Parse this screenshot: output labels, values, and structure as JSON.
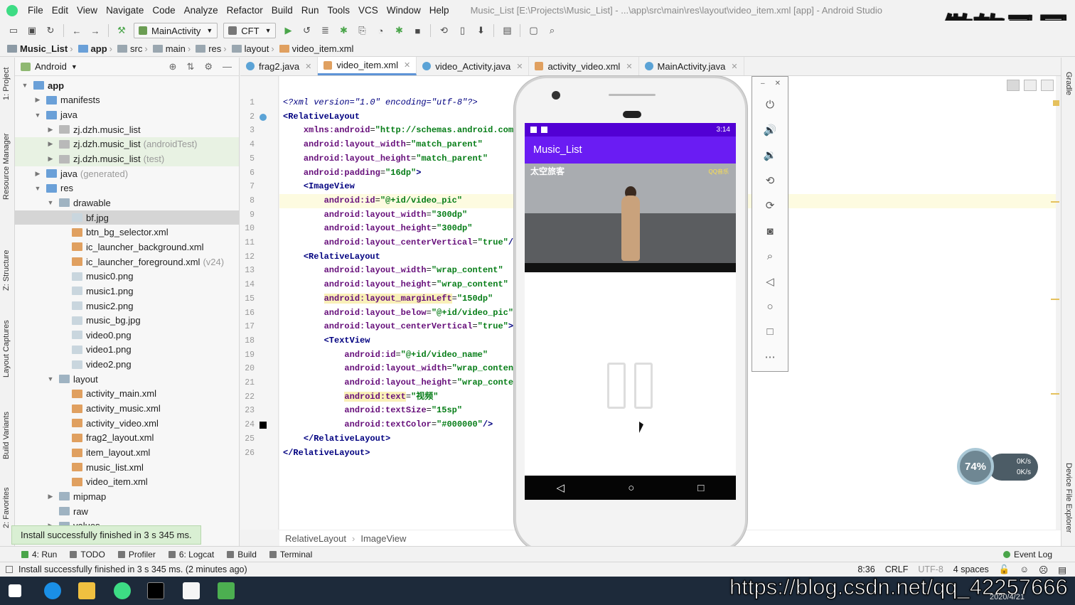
{
  "menu": {
    "items": [
      "File",
      "Edit",
      "View",
      "Navigate",
      "Code",
      "Analyze",
      "Refactor",
      "Build",
      "Run",
      "Tools",
      "VCS",
      "Window",
      "Help"
    ],
    "window_title": "Music_List [E:\\Projects\\Music_List] - ...\\app\\src\\main\\res\\layout\\video_item.xml [app] - Android Studio"
  },
  "watermark": "傲软录屏",
  "toolbar": {
    "run_config": "MainActivity",
    "device": "CFT"
  },
  "breadcrumb": [
    "Music_List",
    "app",
    "src",
    "main",
    "res",
    "layout",
    "video_item.xml"
  ],
  "left_strip": [
    "1: Project",
    "Resource Manager",
    "Z: Structure",
    "Layout Captures",
    "Build Variants",
    "2: Favorites"
  ],
  "right_strip": [
    "Gradle",
    "Device File Explorer"
  ],
  "project": {
    "view_label": "Android",
    "tree": [
      {
        "label": "app",
        "depth": 0,
        "icon": "folderblue",
        "tw": "▼",
        "bold": true
      },
      {
        "label": "manifests",
        "depth": 1,
        "icon": "folderblue",
        "tw": "▶"
      },
      {
        "label": "java",
        "depth": 1,
        "icon": "folderblue",
        "tw": "▼"
      },
      {
        "label": "zj.dzh.music_list",
        "depth": 2,
        "icon": "pkg",
        "tw": "▶"
      },
      {
        "label": "zj.dzh.music_list",
        "suffix": "(androidTest)",
        "depth": 2,
        "icon": "pkg",
        "tw": "▶",
        "hl": true
      },
      {
        "label": "zj.dzh.music_list",
        "suffix": "(test)",
        "depth": 2,
        "icon": "pkg",
        "tw": "▶",
        "hl": true
      },
      {
        "label": "java",
        "suffix": "(generated)",
        "depth": 1,
        "icon": "folderblue",
        "tw": "▶"
      },
      {
        "label": "res",
        "depth": 1,
        "icon": "folderblue",
        "tw": "▼"
      },
      {
        "label": "drawable",
        "depth": 2,
        "icon": "folder",
        "tw": "▼"
      },
      {
        "label": "bf.jpg",
        "depth": 3,
        "icon": "img",
        "tw": "",
        "sel": true
      },
      {
        "label": "btn_bg_selector.xml",
        "depth": 3,
        "icon": "xml",
        "tw": ""
      },
      {
        "label": "ic_launcher_background.xml",
        "depth": 3,
        "icon": "xml",
        "tw": ""
      },
      {
        "label": "ic_launcher_foreground.xml",
        "suffix": "(v24)",
        "depth": 3,
        "icon": "xml",
        "tw": ""
      },
      {
        "label": "music0.png",
        "depth": 3,
        "icon": "img",
        "tw": ""
      },
      {
        "label": "music1.png",
        "depth": 3,
        "icon": "img",
        "tw": ""
      },
      {
        "label": "music2.png",
        "depth": 3,
        "icon": "img",
        "tw": ""
      },
      {
        "label": "music_bg.jpg",
        "depth": 3,
        "icon": "img",
        "tw": ""
      },
      {
        "label": "video0.png",
        "depth": 3,
        "icon": "img",
        "tw": ""
      },
      {
        "label": "video1.png",
        "depth": 3,
        "icon": "img",
        "tw": ""
      },
      {
        "label": "video2.png",
        "depth": 3,
        "icon": "img",
        "tw": ""
      },
      {
        "label": "layout",
        "depth": 2,
        "icon": "folder",
        "tw": "▼"
      },
      {
        "label": "activity_main.xml",
        "depth": 3,
        "icon": "xml",
        "tw": ""
      },
      {
        "label": "activity_music.xml",
        "depth": 3,
        "icon": "xml",
        "tw": ""
      },
      {
        "label": "activity_video.xml",
        "depth": 3,
        "icon": "xml",
        "tw": ""
      },
      {
        "label": "frag2_layout.xml",
        "depth": 3,
        "icon": "xml",
        "tw": ""
      },
      {
        "label": "item_layout.xml",
        "depth": 3,
        "icon": "xml",
        "tw": ""
      },
      {
        "label": "music_list.xml",
        "depth": 3,
        "icon": "xml",
        "tw": ""
      },
      {
        "label": "video_item.xml",
        "depth": 3,
        "icon": "xml",
        "tw": ""
      },
      {
        "label": "mipmap",
        "depth": 2,
        "icon": "folder",
        "tw": "▶"
      },
      {
        "label": "raw",
        "depth": 2,
        "icon": "folder",
        "tw": ""
      },
      {
        "label": "values",
        "depth": 2,
        "icon": "folder",
        "tw": "▶"
      }
    ]
  },
  "toast": "Install successfully finished in 3 s 345 ms.",
  "tabs": [
    {
      "label": "frag2.java",
      "kind": "java"
    },
    {
      "label": "video_item.xml",
      "kind": "xml",
      "active": true
    },
    {
      "label": "video_Activity.java",
      "kind": "java"
    },
    {
      "label": "activity_video.xml",
      "kind": "xml"
    },
    {
      "label": "MainActivity.java",
      "kind": "java"
    }
  ],
  "code_lines": [
    [
      [
        "pi",
        "<?xml version=\"1.0\" encoding=\"utf-8\"?>"
      ]
    ],
    [
      [
        "tag",
        "<RelativeLayout"
      ]
    ],
    [
      [
        "",
        "    "
      ],
      [
        "attr",
        "xmlns:android"
      ],
      [
        "",
        "="
      ],
      [
        "val",
        "\"http://schemas.android.com/"
      ]
    ],
    [
      [
        "",
        "    "
      ],
      [
        "attr",
        "android:layout_width"
      ],
      [
        "",
        "="
      ],
      [
        "val",
        "\"match_parent\""
      ]
    ],
    [
      [
        "",
        "    "
      ],
      [
        "attr",
        "android:layout_height"
      ],
      [
        "",
        "="
      ],
      [
        "val",
        "\"match_parent\""
      ]
    ],
    [
      [
        "",
        "    "
      ],
      [
        "attr",
        "android:padding"
      ],
      [
        "",
        "="
      ],
      [
        "val",
        "\"16dp\""
      ],
      [
        "tag",
        ">"
      ]
    ],
    [
      [
        "",
        "    "
      ],
      [
        "tag",
        "<ImageView"
      ]
    ],
    [
      [
        "",
        "        "
      ],
      [
        "attr",
        "android:id"
      ],
      [
        "",
        "="
      ],
      [
        "val",
        "\"@+id/video_pic\""
      ]
    ],
    [
      [
        "",
        "        "
      ],
      [
        "attr",
        "android:layout_width"
      ],
      [
        "",
        "="
      ],
      [
        "val",
        "\"300dp\""
      ]
    ],
    [
      [
        "",
        "        "
      ],
      [
        "attr",
        "android:layout_height"
      ],
      [
        "",
        "="
      ],
      [
        "val",
        "\"300dp\""
      ]
    ],
    [
      [
        "",
        "        "
      ],
      [
        "attr",
        "android:layout_centerVertical"
      ],
      [
        "",
        "="
      ],
      [
        "val",
        "\"true\""
      ],
      [
        "tag",
        "/>"
      ]
    ],
    [
      [
        "",
        "    "
      ],
      [
        "tag",
        "<RelativeLayout"
      ]
    ],
    [
      [
        "",
        "        "
      ],
      [
        "attr",
        "android:layout_width"
      ],
      [
        "",
        "="
      ],
      [
        "val",
        "\"wrap_content\""
      ]
    ],
    [
      [
        "",
        "        "
      ],
      [
        "attr",
        "android:layout_height"
      ],
      [
        "",
        "="
      ],
      [
        "val",
        "\"wrap_content\""
      ]
    ],
    [
      [
        "",
        "        "
      ],
      [
        "hlattr",
        "android:layout_marginLeft"
      ],
      [
        "",
        "="
      ],
      [
        "val",
        "\"150dp\""
      ]
    ],
    [
      [
        "",
        "        "
      ],
      [
        "attr",
        "android:layout_below"
      ],
      [
        "",
        "="
      ],
      [
        "val",
        "\"@+id/video_pic\""
      ]
    ],
    [
      [
        "",
        "        "
      ],
      [
        "attr",
        "android:layout_centerVertical"
      ],
      [
        "",
        "="
      ],
      [
        "val",
        "\"true\""
      ],
      [
        "tag",
        ">"
      ]
    ],
    [
      [
        "",
        "        "
      ],
      [
        "tag",
        "<TextView"
      ]
    ],
    [
      [
        "",
        "            "
      ],
      [
        "attr",
        "android:id"
      ],
      [
        "",
        "="
      ],
      [
        "val",
        "\"@+id/video_name\""
      ]
    ],
    [
      [
        "",
        "            "
      ],
      [
        "attr",
        "android:layout_width"
      ],
      [
        "",
        "="
      ],
      [
        "val",
        "\"wrap_content"
      ]
    ],
    [
      [
        "",
        "            "
      ],
      [
        "attr",
        "android:layout_height"
      ],
      [
        "",
        "="
      ],
      [
        "val",
        "\"wrap_conten"
      ]
    ],
    [
      [
        "",
        "            "
      ],
      [
        "hlattr",
        "android:text"
      ],
      [
        "",
        "="
      ],
      [
        "val",
        "\"视频\""
      ]
    ],
    [
      [
        "",
        "            "
      ],
      [
        "attr",
        "android:textSize"
      ],
      [
        "",
        "="
      ],
      [
        "val",
        "\"15sp\""
      ]
    ],
    [
      [
        "",
        "            "
      ],
      [
        "attr",
        "android:textColor"
      ],
      [
        "",
        "="
      ],
      [
        "val",
        "\"#000000\""
      ],
      [
        "tag",
        "/>"
      ]
    ],
    [
      [
        "",
        "    "
      ],
      [
        "tag",
        "</RelativeLayout>"
      ]
    ],
    [
      [
        "tag",
        "</RelativeLayout>"
      ]
    ]
  ],
  "editor_breadcrumb": [
    "RelativeLayout",
    "ImageView"
  ],
  "bottom_tools": [
    "4: Run",
    "TODO",
    "Profiler",
    "6: Logcat",
    "Build",
    "Terminal"
  ],
  "event_log": "Event Log",
  "status": {
    "message": "Install successfully finished in 3 s 345 ms. (2 minutes ago)",
    "position": "8:36",
    "line_sep": "CRLF",
    "encoding": "UTF-8",
    "indent": "4 spaces"
  },
  "emulator": {
    "time": "3:14",
    "app_title": "Music_List",
    "video_overlay": "太空旅客",
    "video_logo": "QQ音乐"
  },
  "network_widget": {
    "percent": "74%",
    "up": "0K/s",
    "down": "0K/s"
  },
  "taskbar": {
    "url": "https://blog.csdn.net/qq_42257666",
    "date": "2020/4/21"
  },
  "colors": {
    "accent": "#6a1cf3",
    "statusbar": "#5200d4",
    "toast_bg": "#d9efd3"
  }
}
